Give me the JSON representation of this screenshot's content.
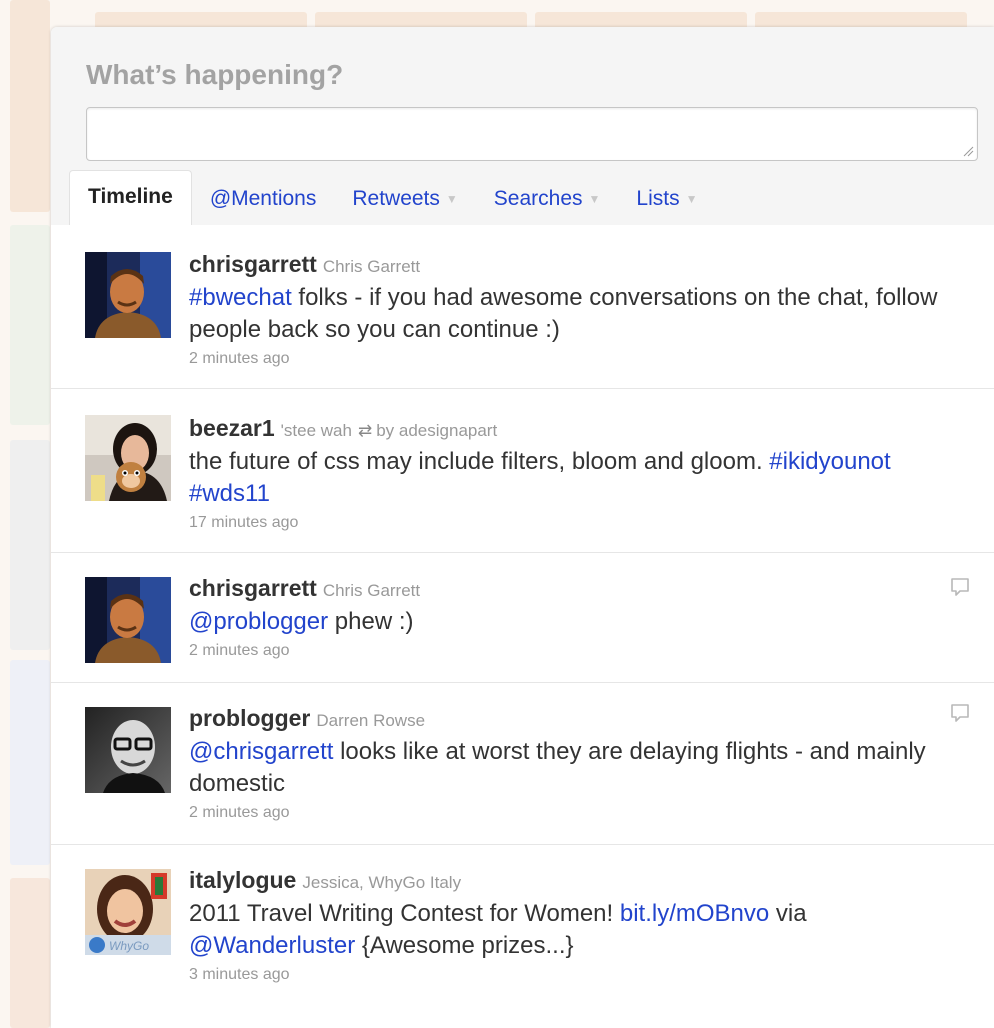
{
  "compose": {
    "title": "What’s happening?",
    "placeholder": ""
  },
  "tabs": [
    {
      "label": "Timeline",
      "active": true,
      "dropdown": false
    },
    {
      "label": "@Mentions",
      "active": false,
      "dropdown": false
    },
    {
      "label": "Retweets",
      "active": false,
      "dropdown": true
    },
    {
      "label": "Searches",
      "active": false,
      "dropdown": true
    },
    {
      "label": "Lists",
      "active": false,
      "dropdown": true
    }
  ],
  "tweets": [
    {
      "screen_name": "chrisgarrett",
      "full_name": "Chris Garrett",
      "text_parts": [
        {
          "t": "#bwechat",
          "link": true
        },
        {
          "t": " folks - if you had awesome conversations on the chat, follow people back so you can continue :)",
          "link": false
        }
      ],
      "time": "2 minutes ago",
      "avatar": "chrisgarrett-avatar",
      "reply": false
    },
    {
      "screen_name": "beezar1",
      "full_name": "'stee wah",
      "retweeted_by": "by adesignapart",
      "text_parts": [
        {
          "t": "the future of css may include filters, bloom and gloom. ",
          "link": false
        },
        {
          "t": "#ikidyounot",
          "link": true
        },
        {
          "t": " ",
          "link": false
        },
        {
          "t": "#wds11",
          "link": true
        }
      ],
      "time": "17 minutes ago",
      "avatar": "beezar1-avatar",
      "reply": false
    },
    {
      "screen_name": "chrisgarrett",
      "full_name": "Chris Garrett",
      "text_parts": [
        {
          "t": "@problogger",
          "link": true
        },
        {
          "t": " phew :)",
          "link": false
        }
      ],
      "time": "2 minutes ago",
      "avatar": "chrisgarrett-avatar",
      "reply": true
    },
    {
      "screen_name": "problogger",
      "full_name": "Darren Rowse",
      "text_parts": [
        {
          "t": "@chrisgarrett",
          "link": true
        },
        {
          "t": " looks like at worst they are delaying flights - and mainly domestic",
          "link": false
        }
      ],
      "time": "2 minutes ago",
      "avatar": "problogger-avatar",
      "reply": true
    },
    {
      "screen_name": "italylogue",
      "full_name": "Jessica, WhyGo Italy",
      "text_parts": [
        {
          "t": "2011 Travel Writing Contest for Women! ",
          "link": false
        },
        {
          "t": "bit.ly/mOBnvo",
          "link": true
        },
        {
          "t": " via ",
          "link": false
        },
        {
          "t": "@Wanderluster",
          "link": true
        },
        {
          "t": " {Awesome prizes...}",
          "link": false
        }
      ],
      "time": "3 minutes ago",
      "avatar": "italylogue-avatar",
      "avatar_badge": "WhyGo",
      "reply": false
    }
  ],
  "colors": {
    "link": "#2244cc",
    "muted": "#999999",
    "text": "#333333"
  }
}
